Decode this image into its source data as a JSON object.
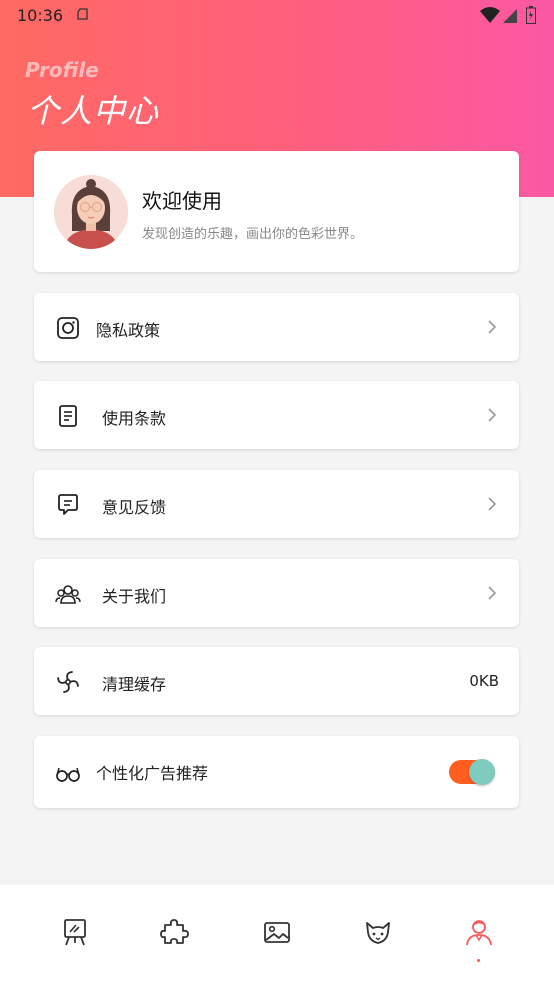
{
  "status_bar": {
    "time": "10:36"
  },
  "header": {
    "subtitle_en": "Profile",
    "title": "个人中心"
  },
  "welcome": {
    "title": "欢迎使用",
    "subtitle": "发现创造的乐趣，画出你的色彩世界。"
  },
  "menu": [
    {
      "label": "隐私政策",
      "icon": "instagram-icon"
    },
    {
      "label": "使用条款",
      "icon": "document-icon"
    },
    {
      "label": "意见反馈",
      "icon": "feedback-icon"
    },
    {
      "label": "关于我们",
      "icon": "group-icon"
    },
    {
      "label": "清理缓存",
      "icon": "fan-icon",
      "value": "0KB"
    },
    {
      "label": "个性化广告推荐",
      "icon": "glasses-icon",
      "toggle_on": true
    }
  ],
  "tabbar": {
    "items": [
      "easel-icon",
      "puzzle-icon",
      "picture-icon",
      "fox-icon",
      "profile-icon"
    ],
    "active_index": 4,
    "active_color": "#f35b5b"
  }
}
